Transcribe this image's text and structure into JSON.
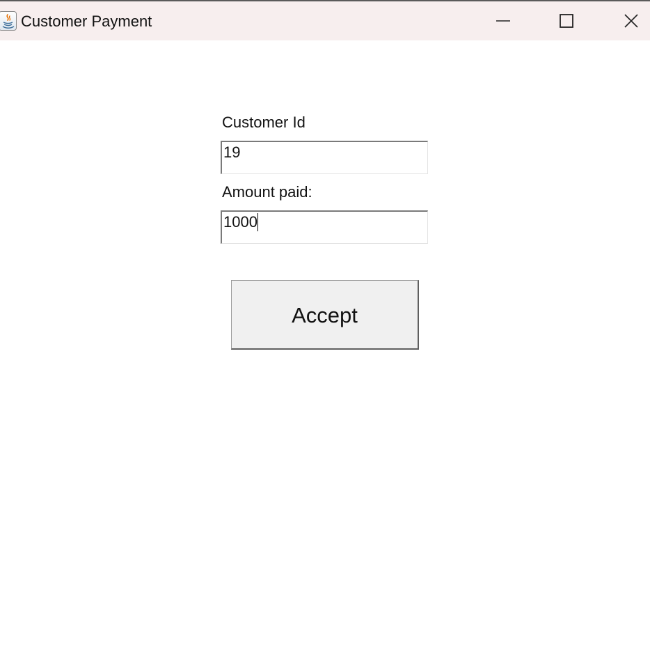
{
  "window": {
    "title": "Customer Payment",
    "icon": "java-app-icon",
    "controls": [
      "minimize-icon",
      "maximize-icon",
      "close-icon"
    ]
  },
  "form": {
    "customer_id_label": "Customer Id",
    "customer_id_value": "19",
    "amount_paid_label": "Amount paid:",
    "amount_paid_value": "1000",
    "accept_label": "Accept"
  },
  "colors": {
    "titlebar_background": "#f7eeee",
    "button_background": "#f0f0f0"
  }
}
